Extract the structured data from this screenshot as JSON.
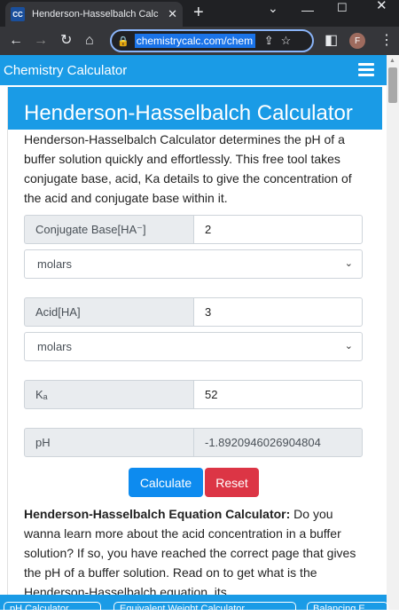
{
  "browser": {
    "tab_title": "Henderson-Hasselbalch Calc",
    "favicon_text": "CC",
    "url": "chemistrycalc.com/chem",
    "profile_initial": "F"
  },
  "site": {
    "brand": "Chemistry Calculator"
  },
  "page": {
    "title": "Henderson-Hasselbalch Calculator",
    "intro": "Henderson-Hasselbalch Calculator determines the pH of a buffer solution quickly and effortlessly. This free tool takes conjugate base, acid, Ka details to give the concentration of the acid and conjugate base within it."
  },
  "form": {
    "conjugate_base_label": "Conjugate Base[HA⁻]",
    "conjugate_base_value": "2",
    "conjugate_base_unit": "molars",
    "acid_label": "Acid[HA]",
    "acid_value": "3",
    "acid_unit": "molars",
    "ka_label": "Kₐ",
    "ka_value": "52",
    "ph_label": "pH",
    "ph_value": "-1.8920946026904804",
    "calculate_label": "Calculate",
    "reset_label": "Reset"
  },
  "article": {
    "heading": "Henderson-Hasselbalch Equation Calculator:",
    "body": " Do you wanna learn more about the acid concentration in a buffer solution? If so, you have reached the correct page that gives the pH of a buffer solution. Read on to get what is the Henderson-Hasselbalch equation, its"
  },
  "related": [
    {
      "label": "pH Calculator"
    },
    {
      "label": "Equivalent Weight Calculator"
    },
    {
      "label": "Balancing E"
    }
  ]
}
